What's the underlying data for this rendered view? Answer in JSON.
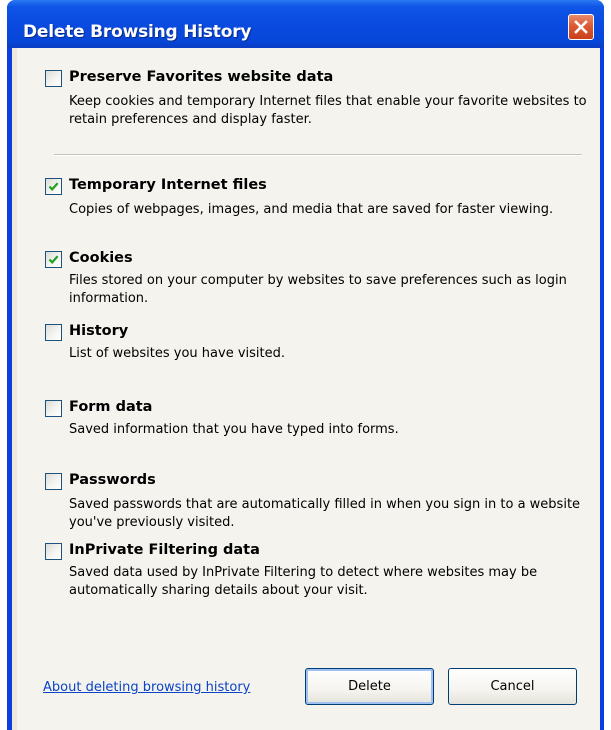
{
  "window": {
    "title": "Delete Browsing History"
  },
  "options": [
    {
      "title": "Preserve Favorites website data",
      "desc": "Keep cookies and temporary Internet files that enable your favorite websites to retain preferences and display faster.",
      "checked": false
    },
    {
      "title": "Temporary Internet files",
      "desc": "Copies of webpages, images, and media that are saved for faster viewing.",
      "checked": true
    },
    {
      "title": "Cookies",
      "desc": "Files stored on your computer by websites to save preferences such as login information.",
      "checked": true
    },
    {
      "title": "History",
      "desc": "List of websites you have visited.",
      "checked": false
    },
    {
      "title": "Form data",
      "desc": "Saved information that you have typed into forms.",
      "checked": false
    },
    {
      "title": "Passwords",
      "desc": "Saved passwords that are automatically filled in when you sign in to a website you've previously visited.",
      "checked": false
    },
    {
      "title": "InPrivate Filtering data",
      "desc": "Saved data used by InPrivate Filtering to detect where websites may be automatically sharing details about your visit.",
      "checked": false
    }
  ],
  "footer": {
    "help_link": "About deleting browsing history",
    "delete_label": "Delete",
    "cancel_label": "Cancel"
  },
  "icons": {
    "close": "close-icon",
    "check": "checkmark-icon"
  },
  "colors": {
    "titlebar": "#0a4ae0",
    "close_button": "#dc5a35",
    "panel": "#f4f3ee",
    "link": "#0b44c6",
    "checkmark": "#21a121",
    "checkbox_border": "#1c5180"
  }
}
